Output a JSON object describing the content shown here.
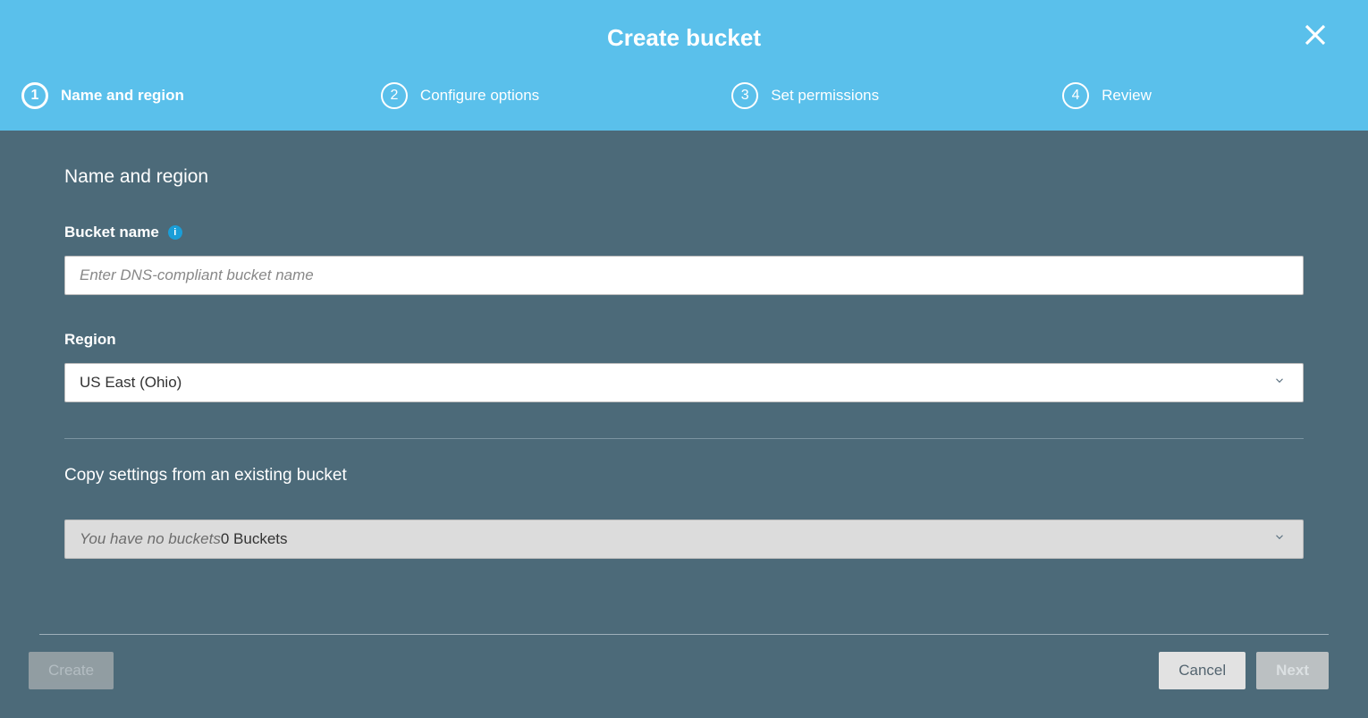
{
  "header": {
    "title": "Create bucket"
  },
  "steps": [
    {
      "num": "1",
      "label": "Name and region",
      "active": true
    },
    {
      "num": "2",
      "label": "Configure options",
      "active": false
    },
    {
      "num": "3",
      "label": "Set permissions",
      "active": false
    },
    {
      "num": "4",
      "label": "Review",
      "active": false
    }
  ],
  "form": {
    "section_title": "Name and region",
    "bucket_name_label": "Bucket name",
    "bucket_name_placeholder": "Enter DNS-compliant bucket name",
    "bucket_name_value": "",
    "region_label": "Region",
    "region_value": "US East (Ohio)",
    "copy_heading": "Copy settings from an existing bucket",
    "copy_placeholder_italic": "You have no buckets",
    "copy_placeholder_suffix": "0 Buckets"
  },
  "footer": {
    "create_label": "Create",
    "cancel_label": "Cancel",
    "next_label": "Next"
  }
}
